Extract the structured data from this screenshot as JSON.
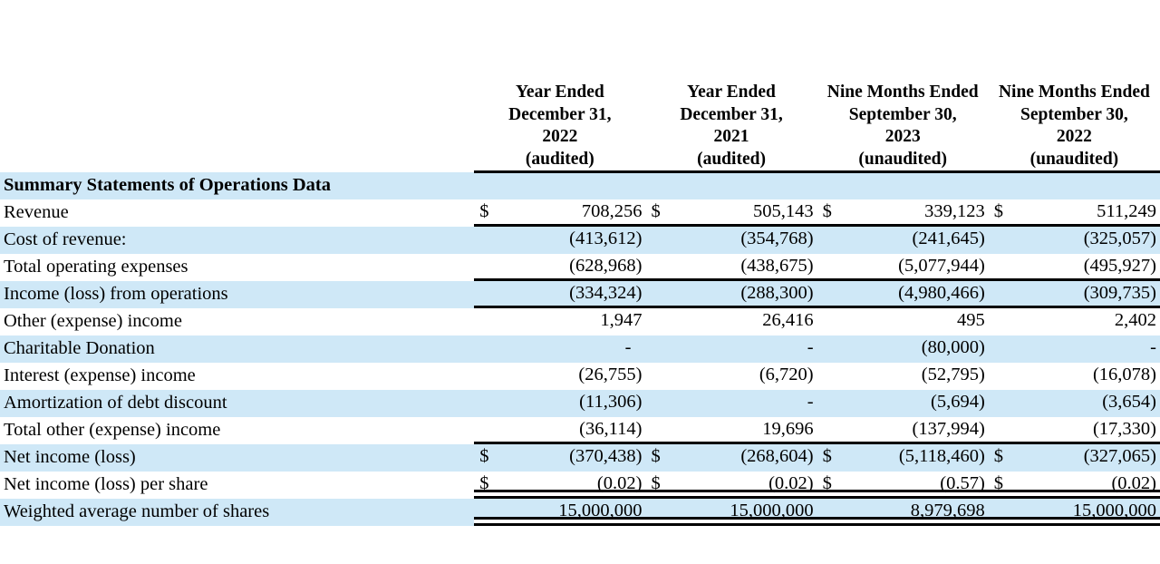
{
  "table": {
    "section_title": "Summary Statements of Operations Data",
    "columns": [
      {
        "header": "Year Ended\nDecember 31,\n2022\n(audited)"
      },
      {
        "header": "Year Ended\nDecember 31,\n2021\n(audited)"
      },
      {
        "header": "Nine Months Ended\nSeptember 30,\n2023\n(unaudited)"
      },
      {
        "header": "Nine Months Ended\nSeptember 30,\n2022\n(unaudited)"
      }
    ],
    "rows": [
      {
        "label": "Revenue",
        "currency": [
          "$",
          "$",
          "$",
          "$"
        ],
        "values": [
          "708,256",
          "505,143",
          "339,123",
          "511,249"
        ]
      },
      {
        "label": "Cost of revenue:",
        "currency": [
          "",
          "",
          "",
          ""
        ],
        "values": [
          "(413,612)",
          "(354,768)",
          "(241,645)",
          "(325,057)"
        ]
      },
      {
        "label": "Total operating expenses",
        "currency": [
          "",
          "",
          "",
          ""
        ],
        "values": [
          "(628,968)",
          "(438,675)",
          "(5,077,944)",
          "(495,927)"
        ]
      },
      {
        "label": "Income (loss) from operations",
        "currency": [
          "",
          "",
          "",
          ""
        ],
        "values": [
          "(334,324)",
          "(288,300)",
          "(4,980,466)",
          "(309,735)"
        ]
      },
      {
        "label": "Other (expense) income",
        "currency": [
          "",
          "",
          "",
          ""
        ],
        "values": [
          "1,947",
          "26,416",
          "495",
          "2,402"
        ]
      },
      {
        "label": "Charitable Donation",
        "currency": [
          "",
          "",
          "",
          ""
        ],
        "values": [
          "-",
          "-",
          "(80,000)",
          "-"
        ]
      },
      {
        "label": "Interest (expense) income",
        "currency": [
          "",
          "",
          "",
          ""
        ],
        "values": [
          "(26,755)",
          "(6,720)",
          "(52,795)",
          "(16,078)"
        ]
      },
      {
        "label": "Amortization of debt discount",
        "currency": [
          "",
          "",
          "",
          ""
        ],
        "values": [
          "(11,306)",
          "-",
          "(5,694)",
          "(3,654)"
        ]
      },
      {
        "label": "Total other (expense) income",
        "currency": [
          "",
          "",
          "",
          ""
        ],
        "values": [
          "(36,114)",
          "19,696",
          "(137,994)",
          "(17,330)"
        ]
      },
      {
        "label": "Net income (loss)",
        "currency": [
          "$",
          "$",
          "$",
          "$"
        ],
        "values": [
          "(370,438)",
          "(268,604)",
          "(5,118,460)",
          "(327,065)"
        ]
      },
      {
        "label": "Net income (loss) per share",
        "currency": [
          "$",
          "$",
          "$",
          "$"
        ],
        "values": [
          "(0.02)",
          "(0.02)",
          "(0.57)",
          "(0.02)"
        ]
      },
      {
        "label": "Weighted average number of shares",
        "currency": [
          "",
          "",
          "",
          ""
        ],
        "values": [
          "15,000,000",
          "15,000,000",
          "8,979,698",
          "15,000,000"
        ]
      }
    ]
  },
  "style": {
    "band_color": "#cfe8f7",
    "rule_color": "#000000",
    "background": "#ffffff"
  }
}
